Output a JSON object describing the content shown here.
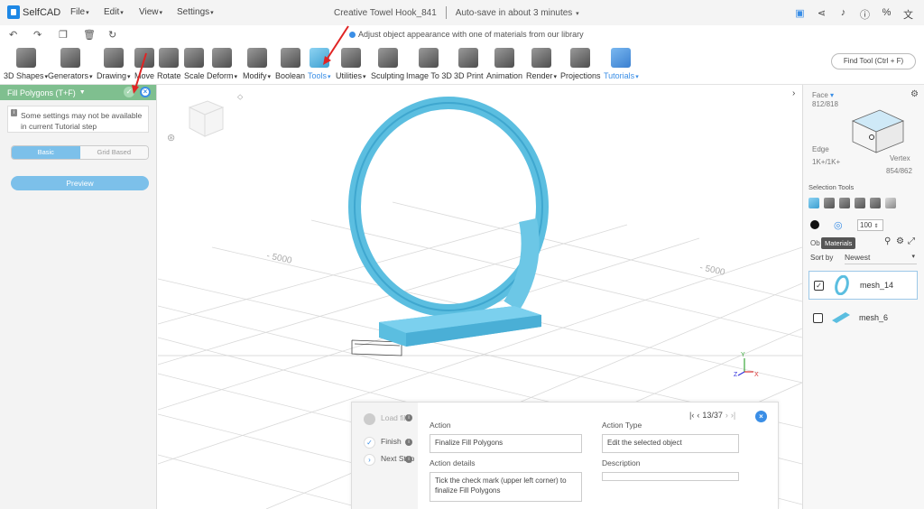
{
  "app": {
    "logo_text": "SelfCAD",
    "menus": [
      "File",
      "Edit",
      "View",
      "Settings"
    ],
    "project_title": "Creative Towel Hook_841",
    "autosave": "Auto-save in about 3 minutes",
    "top_icons": [
      "save-icon",
      "share-icon",
      "bell-icon",
      "info-icon",
      "percent-icon",
      "translate-icon"
    ]
  },
  "quickbar": {
    "icons": [
      "undo-icon",
      "redo-icon",
      "copy-icon",
      "delete-icon",
      "refresh-icon"
    ],
    "hint": "Adjust object appearance with one of materials from our library"
  },
  "ribbon": {
    "tools": [
      {
        "label": "3D Shapes",
        "caret": true
      },
      {
        "label": "Generators",
        "caret": true
      },
      {
        "label": "Drawing",
        "caret": true
      },
      {
        "label": "Move",
        "caret": false
      },
      {
        "label": "Rotate",
        "caret": false
      },
      {
        "label": "Scale",
        "caret": false
      },
      {
        "label": "Deform",
        "caret": true
      },
      {
        "label": "Modify",
        "caret": true
      },
      {
        "label": "Boolean",
        "caret": false
      },
      {
        "label": "Tools",
        "caret": true
      },
      {
        "label": "Utilities",
        "caret": true
      },
      {
        "label": "Sculpting",
        "caret": false
      },
      {
        "label": "Image To 3D",
        "caret": false
      },
      {
        "label": "3D Print",
        "caret": false
      },
      {
        "label": "Animation",
        "caret": false
      },
      {
        "label": "Render",
        "caret": true
      },
      {
        "label": "Projections",
        "caret": false
      },
      {
        "label": "Tutorials",
        "caret": true
      }
    ],
    "find_tool": "Find Tool (Ctrl + F)"
  },
  "left_panel": {
    "title": "Fill Polygons (T+F)",
    "note": "Some settings may not be available in current Tutorial step",
    "mode_basic": "Basic",
    "mode_grid": "Grid Based",
    "preview": "Preview"
  },
  "viewport": {
    "grid_label_left": "- 5000",
    "grid_label_right": "- 5000",
    "axis_labels": [
      "Y",
      "Z",
      "X"
    ]
  },
  "right_panel": {
    "face_label": "Face",
    "face_count": "812/818",
    "edge_label": "Edge",
    "edge_count": "1K+/1K+",
    "vertex_label": "Vertex",
    "vertex_count": "854/862",
    "selection_tools": "Selection Tools",
    "opacity": "100",
    "tooltip": "Materials",
    "objects_prefix": "Ob",
    "sort_by": "Sort by",
    "sort_value": "Newest",
    "objects": [
      {
        "name": "mesh_14",
        "checked": true
      },
      {
        "name": "mesh_6",
        "checked": false
      }
    ]
  },
  "tutorial": {
    "steps": [
      {
        "label": "Load file",
        "state": "disabled"
      },
      {
        "label": "Finish",
        "state": "done"
      },
      {
        "label": "Next Step",
        "state": "next"
      }
    ],
    "nav": "13/37",
    "action_label": "Action",
    "action_value": "Finalize Fill Polygons",
    "action_details_label": "Action details",
    "action_details_value": "Tick the check mark (upper left corner) to finalize Fill Polygons",
    "action_type_label": "Action Type",
    "action_type_value": "Edit the selected object",
    "description_label": "Description",
    "description_value": ""
  },
  "colors": {
    "accent": "#3a8ee6",
    "object": "#5bbee0",
    "panel_header": "#7fbf8f"
  }
}
